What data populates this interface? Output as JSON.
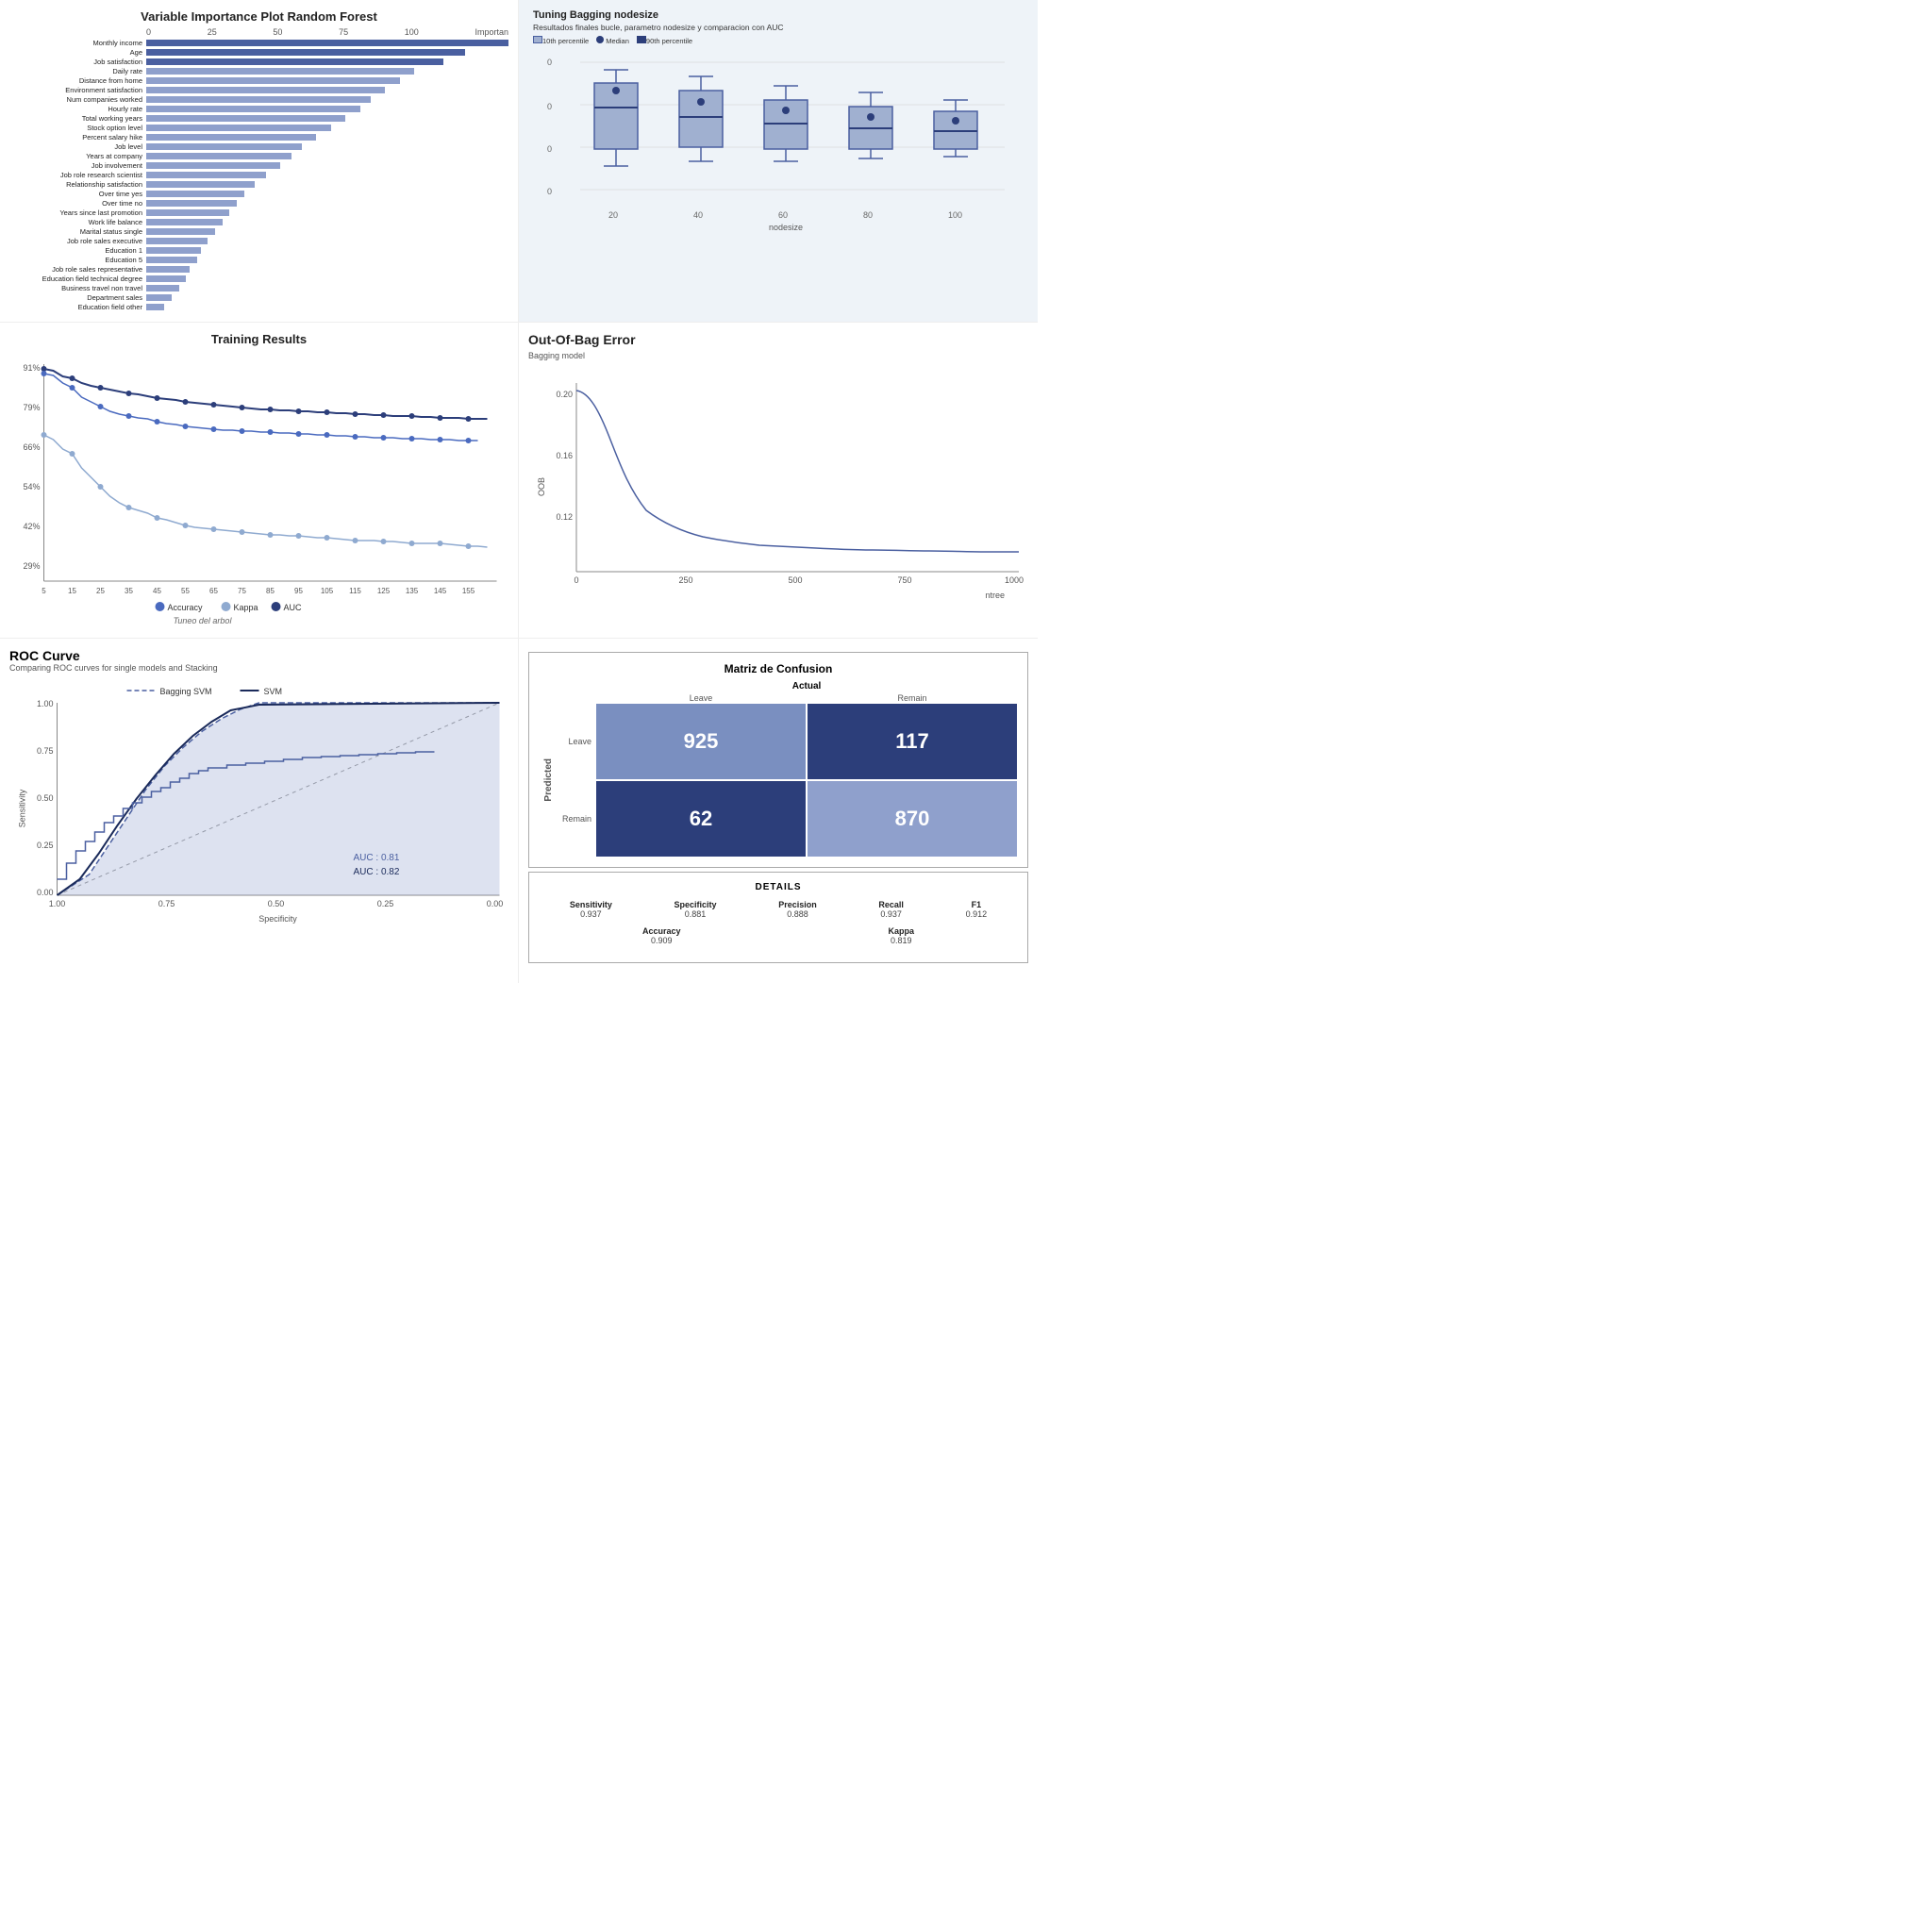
{
  "variableImportance": {
    "title": "Variable Importance Plot Random Forest",
    "xAxisLabel": "Importan",
    "xTicks": [
      "0",
      "25",
      "50",
      "75",
      "100"
    ],
    "variables": [
      {
        "label": "Monthly income",
        "value": 100,
        "dark": true
      },
      {
        "label": "Age",
        "value": 88,
        "dark": true
      },
      {
        "label": "Job satisfaction",
        "value": 82,
        "dark": true
      },
      {
        "label": "Daily rate",
        "value": 74,
        "dark": false
      },
      {
        "label": "Distance from home",
        "value": 70,
        "dark": false
      },
      {
        "label": "Environment satisfaction",
        "value": 66,
        "dark": false
      },
      {
        "label": "Num companies worked",
        "value": 62,
        "dark": false
      },
      {
        "label": "Hourly rate",
        "value": 59,
        "dark": false
      },
      {
        "label": "Total working years",
        "value": 55,
        "dark": false
      },
      {
        "label": "Stock option level",
        "value": 51,
        "dark": false
      },
      {
        "label": "Percent salary hike",
        "value": 47,
        "dark": false
      },
      {
        "label": "Job level",
        "value": 43,
        "dark": false
      },
      {
        "label": "Years at company",
        "value": 40,
        "dark": false
      },
      {
        "label": "Job involvement",
        "value": 37,
        "dark": false
      },
      {
        "label": "Job role research scientist",
        "value": 33,
        "dark": false
      },
      {
        "label": "Relationship satisfaction",
        "value": 30,
        "dark": false
      },
      {
        "label": "Over time yes",
        "value": 27,
        "dark": false
      },
      {
        "label": "Over time no",
        "value": 25,
        "dark": false
      },
      {
        "label": "Years since last promotion",
        "value": 23,
        "dark": false
      },
      {
        "label": "Work life balance",
        "value": 21,
        "dark": false
      },
      {
        "label": "Marital status single",
        "value": 19,
        "dark": false
      },
      {
        "label": "Job role sales executive",
        "value": 17,
        "dark": false
      },
      {
        "label": "Education 1",
        "value": 15,
        "dark": false
      },
      {
        "label": "Education 5",
        "value": 14,
        "dark": false
      },
      {
        "label": "Job role sales representative",
        "value": 12,
        "dark": false
      },
      {
        "label": "Education field technical degree",
        "value": 11,
        "dark": false
      },
      {
        "label": "Business travel non travel",
        "value": 9,
        "dark": false
      },
      {
        "label": "Department sales",
        "value": 7,
        "dark": false
      },
      {
        "label": "Education field other",
        "value": 5,
        "dark": false
      }
    ]
  },
  "tuningBagging": {
    "title": "Tuning Bagging nodesize",
    "subtitle": "Resultados finales bucle, parametro nodesize y comparacion con AUC",
    "legend": {
      "percentile10": "10th percentile",
      "median": "Median",
      "percentile90": "90th percentile"
    },
    "xLabel": "nodesize",
    "xTicks": [
      "20",
      "40",
      "60",
      "80",
      "100"
    ],
    "boxes": [
      {
        "nodesize": "20",
        "top": 10,
        "q1": 30,
        "q3": 80,
        "bottom": 100,
        "dotPos": 25
      },
      {
        "nodesize": "40",
        "top": 20,
        "q1": 40,
        "q3": 70,
        "bottom": 90,
        "dotPos": 45
      },
      {
        "nodesize": "60",
        "top": 30,
        "q1": 45,
        "q3": 65,
        "bottom": 85,
        "dotPos": 50
      },
      {
        "nodesize": "80",
        "top": 40,
        "q1": 50,
        "q3": 62,
        "bottom": 80,
        "dotPos": 55
      },
      {
        "nodesize": "100",
        "top": 45,
        "q1": 52,
        "q3": 60,
        "bottom": 75,
        "dotPos": 56
      }
    ]
  },
  "trainingResults": {
    "title": "Training Results",
    "yTicks": [
      "91%",
      "79%",
      "66%",
      "54%",
      "42%",
      "29%"
    ],
    "xTicks": [
      "5",
      "15",
      "25",
      "35",
      "45",
      "55",
      "65",
      "75",
      "85",
      "95",
      "105",
      "115",
      "125",
      "135",
      "145",
      "155"
    ],
    "legend": {
      "accuracy": "Accuracy",
      "kappa": "Kappa",
      "auc": "AUC"
    },
    "subtitle": "Tuneo del arbol"
  },
  "oobError": {
    "title": "Out-Of-Bag Error",
    "subtitle": "Bagging model",
    "yLabel": "OOB",
    "xLabel": "ntree",
    "yTicks": [
      "0.20",
      "0.16",
      "0.12"
    ],
    "xTicks": [
      "0",
      "250",
      "500",
      "750",
      "1000"
    ]
  },
  "rocCurve": {
    "title": "ROC Curve",
    "subtitle": "Comparing ROC curves for single models and Stacking",
    "legend": {
      "baggingSVM": "Bagging SVM",
      "svm": "SVM"
    },
    "yLabel": "Sensitivity",
    "xLabel": "Specificity",
    "yTicks": [
      "1.00",
      "0.75",
      "0.50",
      "0.25",
      "0.00"
    ],
    "xTicks": [
      "1.00",
      "0.75",
      "0.50",
      "0.25",
      "0.00"
    ],
    "aucLabels": [
      "AUC : 0.81",
      "AUC : 0.82"
    ]
  },
  "confusionMatrix": {
    "title": "Matriz de Confusion",
    "actualLabel": "Actual",
    "predictedLabel": "Predicted",
    "leaveLabel": "Leave",
    "remainLabel": "Remain",
    "cells": {
      "tp": "925",
      "fp": "117",
      "fn": "62",
      "tn": "870"
    }
  },
  "details": {
    "title": "DETAILS",
    "metrics": [
      {
        "label": "Sensitivity",
        "value": "0.937"
      },
      {
        "label": "Specificity",
        "value": "0.881"
      },
      {
        "label": "Precision",
        "value": "0.888"
      },
      {
        "label": "Recall",
        "value": "0.937"
      },
      {
        "label": "F1",
        "value": "0.912"
      }
    ],
    "accuracy": {
      "label": "Accuracy",
      "value": "0.909"
    },
    "kappa": {
      "label": "Kappa",
      "value": "0.819"
    }
  }
}
